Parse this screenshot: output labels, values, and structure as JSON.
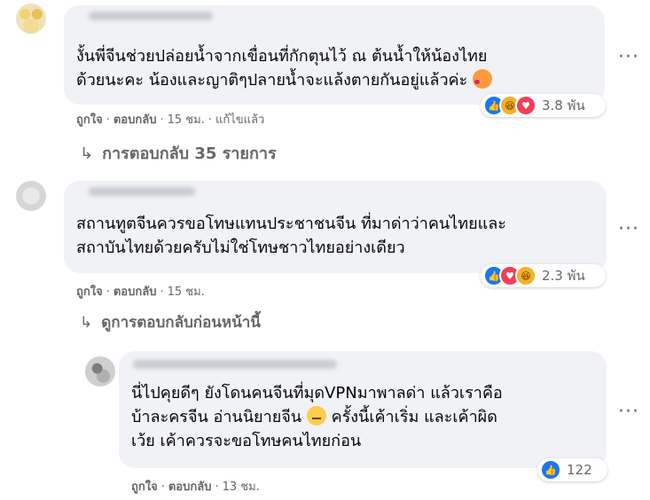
{
  "comments": [
    {
      "text_lines": [
        "งั้นพี่จีนช่วยปล่อยน้ำจากเขื่อนที่กักตุนไว้ ณ ต้นน้ำให้น้องไทย",
        "ด้วยนะคะ น้องและญาติๆปลายน้ำจะแล้งตายกันอยู่แล้วค่ะ"
      ],
      "emoji": "smiling-face-with-hearts",
      "reaction_count": "3.8 พัน",
      "reaction_icons": [
        "like",
        "haha",
        "love"
      ],
      "meta": {
        "like": "ถูกใจ",
        "reply": "ตอบกลับ",
        "time": "15 ชม.",
        "edited": "แก้ไขแล้ว"
      },
      "replies_label": "การตอบกลับ 35 รายการ"
    },
    {
      "text_lines": [
        "สถานทูตจีนควรขอโทษแทนประชาชนจีน ที่มาด่าว่าคนไทยและ",
        "สถาบันไทยด้วยครับไม่ใช่โทษชาวไทยอย่างเดียว"
      ],
      "reaction_count": "2.3 พัน",
      "reaction_icons": [
        "like",
        "love",
        "haha"
      ],
      "meta": {
        "like": "ถูกใจ",
        "reply": "ตอบกลับ",
        "time": "15 ชม."
      },
      "replies_label": "ดูการตอบกลับก่อนหน้านี้"
    },
    {
      "text_lines": [
        "นี่ไปคุยดีๆ ยังโดนคนจีนที่มุดVPNมาพาลด่า แล้วเราคือ",
        "บ้าละครจีน อ่านนิยายจีน",
        "ครั้งนี้เค้าเริ่ม และเค้าผิด",
        "เว้ย เค้าควรจะขอโทษคนไทยก่อน"
      ],
      "emoji": "neutral-face",
      "reaction_count": "122",
      "reaction_icons": [
        "like"
      ],
      "meta": {
        "like": "ถูกใจ",
        "reply": "ตอบกลับ",
        "time": "13 ชม."
      }
    }
  ],
  "icons": {
    "more": "more-horizontal-icon",
    "reply_arrow": "reply-arrow-icon"
  },
  "colors": {
    "like": "#1877f2",
    "love": "#f33e58",
    "haha": "#f7b125",
    "bubble": "#f0f2f5",
    "meta": "#65676b"
  }
}
